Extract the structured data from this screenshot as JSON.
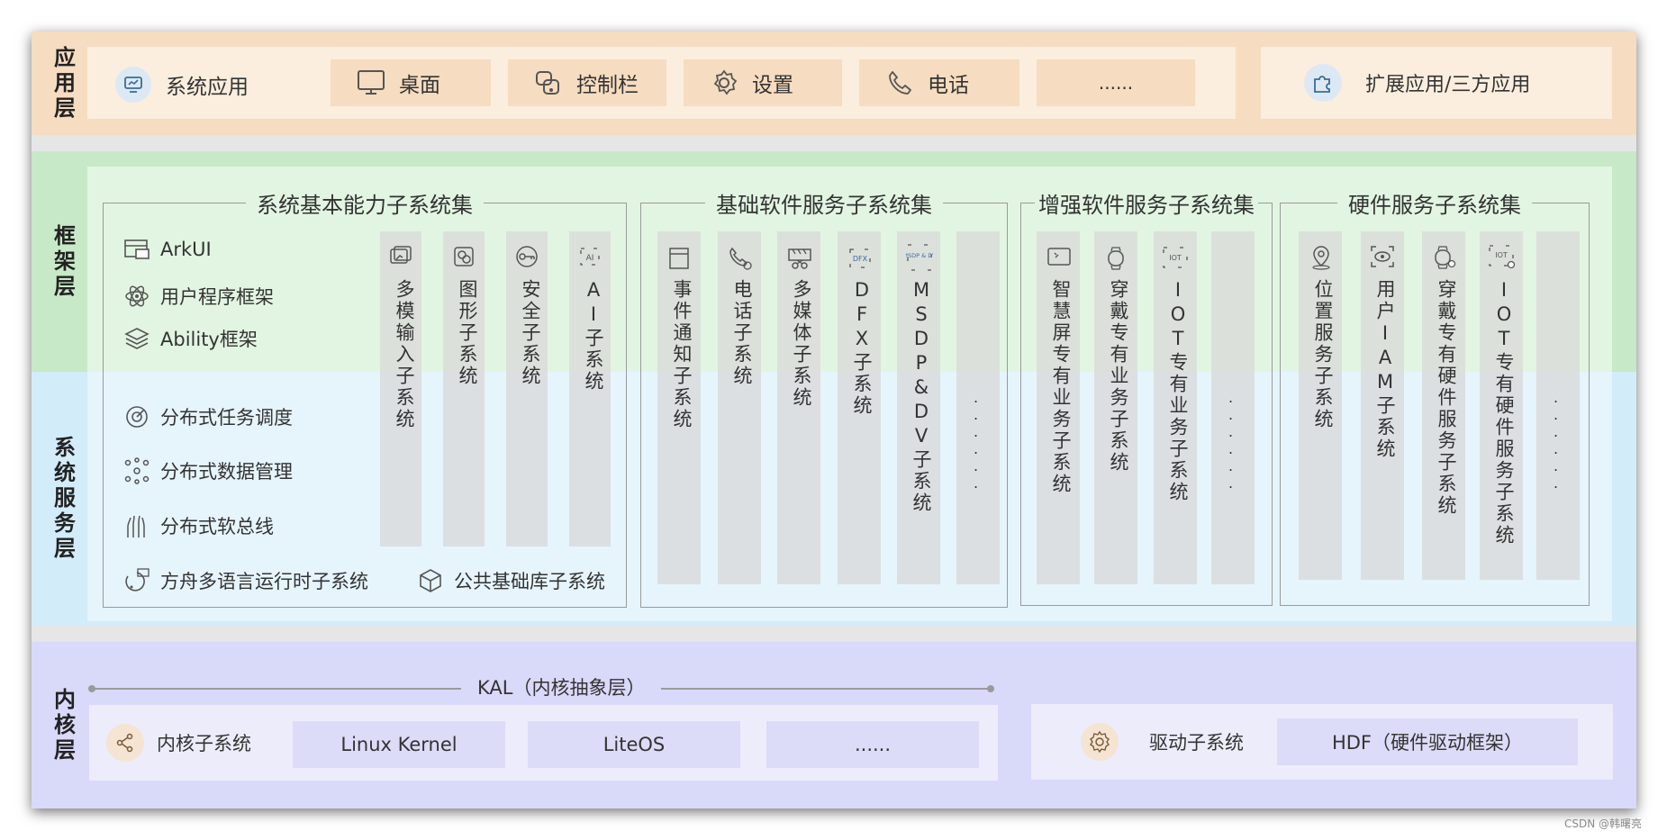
{
  "layers": {
    "app": "应用层",
    "framework": "框架层",
    "system_service": "系统服务层",
    "kernel": "内核层"
  },
  "app_layer": {
    "system_app": "系统应用",
    "items": [
      "桌面",
      "控制栏",
      "设置",
      "电话",
      "......"
    ],
    "extension": "扩展应用/三方应用"
  },
  "groups": {
    "basic": {
      "title": "系统基本能力子系统集",
      "framework_features": [
        "ArkUI",
        "用户程序框架",
        "Ability框架"
      ],
      "service_features": [
        "分布式任务调度",
        "分布式数据管理",
        "分布式软总线"
      ],
      "bottom_left": "方舟多语言运行时子系统",
      "bottom_right": "公共基础库子系统",
      "columns": [
        "多模输入子系统",
        "图形子系统",
        "安全子系统",
        "AI子系统"
      ]
    },
    "software": {
      "title": "基础软件服务子系统集",
      "columns": [
        "事件通知子系统",
        "电话子系统",
        "多媒体子系统",
        "DFX子系统",
        "MSDP&DV子系统",
        "......"
      ]
    },
    "enhanced": {
      "title": "增强软件服务子系统集",
      "columns": [
        "智慧屏专有业务子系统",
        "穿戴专有业务子系统",
        "IOT专有业务子系统",
        "......"
      ]
    },
    "hardware": {
      "title": "硬件服务子系统集",
      "columns": [
        "位置服务子系统",
        "用户IAM子系统",
        "穿戴专有硬件服务子系统",
        "IOT专有硬件服务子系统",
        "......"
      ]
    }
  },
  "column_icon_labels": {
    "ai": "AI",
    "dfx": "DFX",
    "msdp": "MSDP & DV",
    "iot": "IOT"
  },
  "kernel_layer": {
    "kal": "KAL（内核抽象层）",
    "kernel_subsystem": "内核子系统",
    "items": [
      "Linux Kernel",
      "LiteOS",
      "......"
    ],
    "driver_subsystem": "驱动子系统",
    "hdf": "HDF（硬件驱动框架）"
  },
  "watermark": "CSDN @韩曙亮",
  "colors": {
    "app_band": "#f6dcc0",
    "framework_band": "#c7e9c7",
    "service_band": "#d3ecf9",
    "kernel_band": "#d9d9fa"
  }
}
